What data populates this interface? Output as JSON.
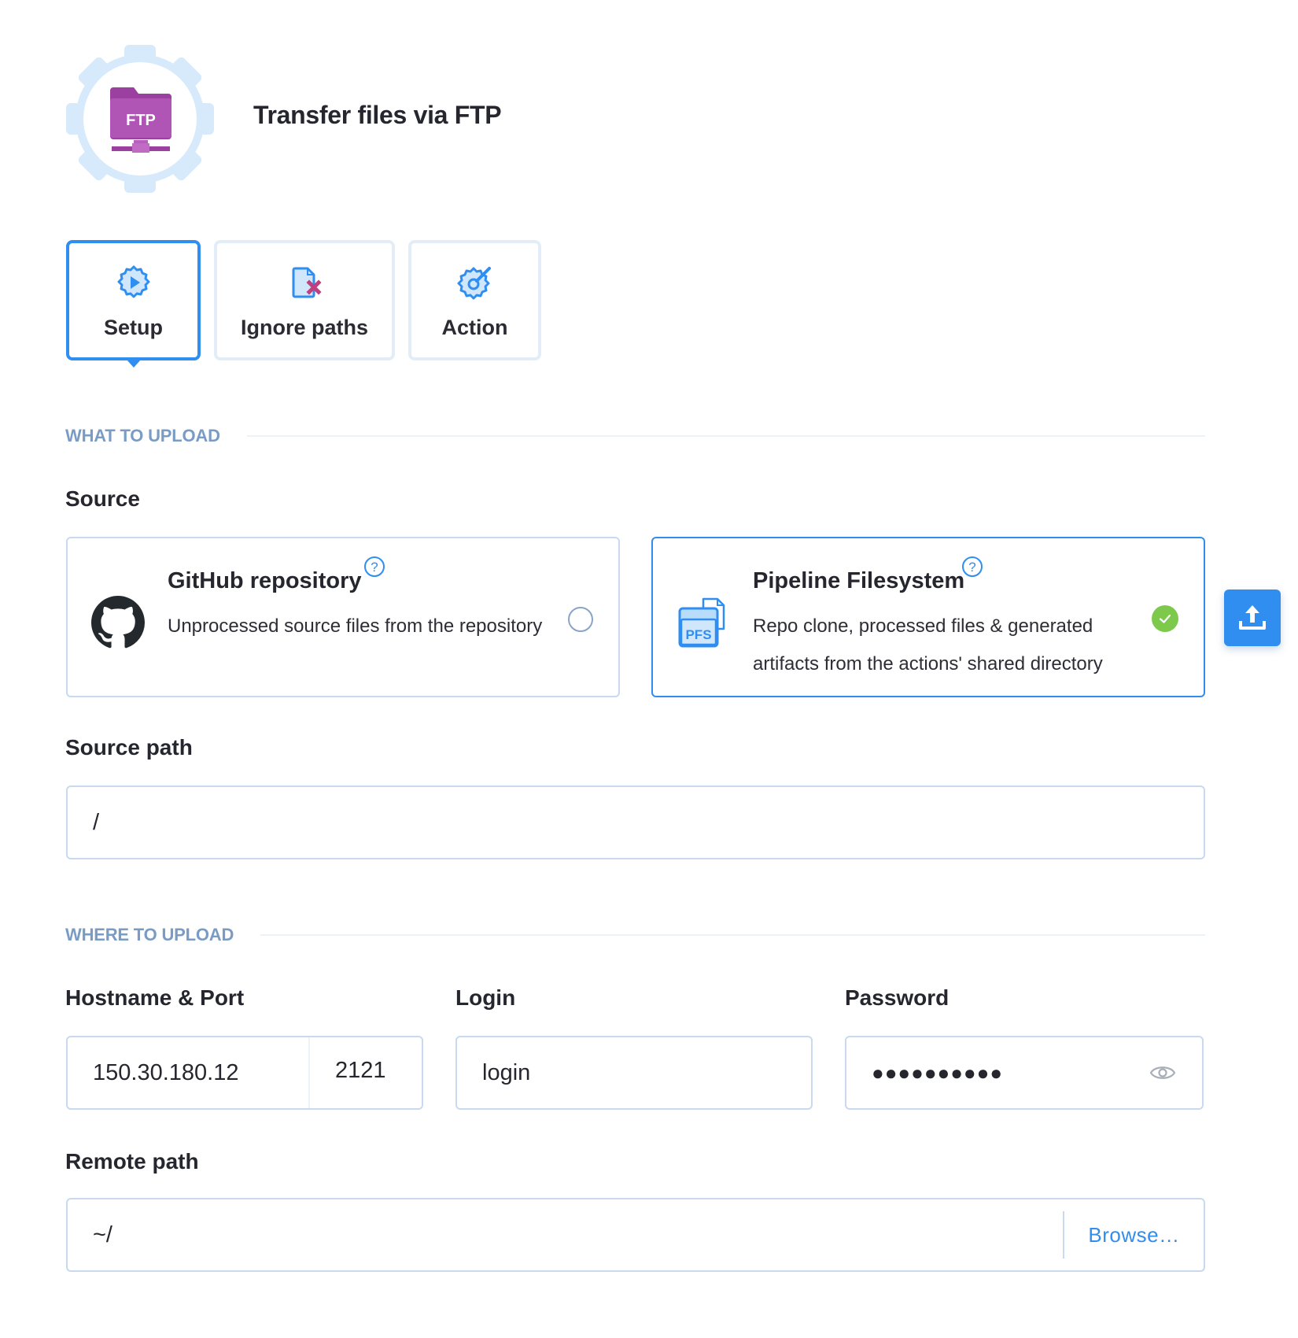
{
  "header": {
    "logo_label": "FTP",
    "title": "Transfer files via FTP"
  },
  "tabs": [
    {
      "label": "Setup",
      "icon": "gear-play-icon",
      "active": true
    },
    {
      "label": "Ignore paths",
      "icon": "file-remove-icon",
      "active": false
    },
    {
      "label": "Action",
      "icon": "gear-wrench-icon",
      "active": false
    }
  ],
  "what_to_upload": {
    "heading": "WHAT TO UPLOAD",
    "source_label": "Source",
    "sources": [
      {
        "title": "GitHub repository",
        "description": "Unprocessed source files from the repository",
        "icon": "github-icon",
        "selected": false
      },
      {
        "title": "Pipeline Filesystem",
        "description": "Repo clone, processed files & generated artifacts from the actions' shared directory",
        "icon": "pfs-icon",
        "icon_label": "PFS",
        "selected": true
      }
    ],
    "source_path_label": "Source path",
    "source_path_value": "/"
  },
  "where_to_upload": {
    "heading": "WHERE TO UPLOAD",
    "hostname_label": "Hostname & Port",
    "hostname_value": "150.30.180.12",
    "port_value": "2121",
    "login_label": "Login",
    "login_value": "login",
    "password_label": "Password",
    "password_value": "●●●●●●●●●●",
    "remote_path_label": "Remote path",
    "remote_path_value": "~/",
    "browse_label": "Browse…"
  },
  "colors": {
    "accent": "#2f8ef0",
    "success": "#7dc94b",
    "section_heading": "#7a9cc4",
    "border": "#c8d9f0",
    "brand_ftp": "#9b3fa0"
  }
}
